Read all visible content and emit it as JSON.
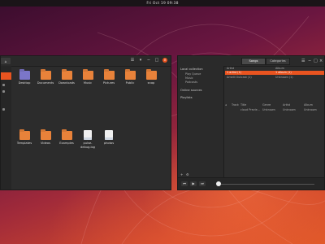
{
  "topbar": {
    "clock": "Fri Oct 19 09:38"
  },
  "files": {
    "path_button": "⌂",
    "header_icons": [
      "☰",
      "▾",
      "−",
      "□"
    ],
    "close": "×",
    "items": [
      {
        "label": "Desktop",
        "type": "folder",
        "color": "purple",
        "icon": "desktop-folder-icon"
      },
      {
        "label": "Documents",
        "type": "folder",
        "color": "orange",
        "icon": "documents-folder-icon"
      },
      {
        "label": "Downloads",
        "type": "folder",
        "color": "orange",
        "icon": "downloads-folder-icon"
      },
      {
        "label": "Music",
        "type": "folder",
        "color": "orange",
        "icon": "music-folder-icon"
      },
      {
        "label": "Pictures",
        "type": "folder",
        "color": "orange",
        "icon": "pictures-folder-icon"
      },
      {
        "label": "Public",
        "type": "folder",
        "color": "orange",
        "icon": "public-folder-icon"
      },
      {
        "label": "snap",
        "type": "folder",
        "color": "orange",
        "icon": "snap-folder-icon"
      },
      {
        "label": "Templates",
        "type": "folder",
        "color": "orange",
        "icon": "templates-folder-icon"
      },
      {
        "label": "Videos",
        "type": "folder",
        "color": "orange",
        "icon": "videos-folder-icon"
      },
      {
        "label": "Examples",
        "type": "folder",
        "color": "orange",
        "icon": "examples-folder-icon"
      },
      {
        "label": "pulse-debug.log",
        "type": "file",
        "icon": "log-file-icon"
      },
      {
        "label": "photos",
        "type": "file",
        "icon": "photos-file-icon"
      }
    ]
  },
  "rhythmbox": {
    "tabs": [
      "Songs",
      "Categories"
    ],
    "header_icons": [
      "☰",
      "−",
      "□",
      "×"
    ],
    "sidebar": {
      "library_title": "Local collection",
      "library_items": [
        "Play Queue",
        "Music",
        "Podcasts"
      ],
      "online_title": "Online sources",
      "playlists_title": "Playlists"
    },
    "browser": {
      "artist_header": "Artist",
      "album_header": "Album",
      "artist_selected": "1 artist (1)",
      "album_selected": "1 album (1)",
      "artist_row2": "Amelli Outcast (1)",
      "album_row2": "Unknown (1)"
    },
    "tracks": {
      "columns": [
        "Track",
        "Title",
        "Genre",
        "Artist",
        "Album"
      ],
      "row": [
        "",
        "cloud Previe...",
        "Unknown",
        "Unknown",
        "Unknown"
      ]
    },
    "controls": {
      "prev": "⏮",
      "play": "▶",
      "next": "⏭",
      "add": "+",
      "settings": "⚙"
    }
  }
}
